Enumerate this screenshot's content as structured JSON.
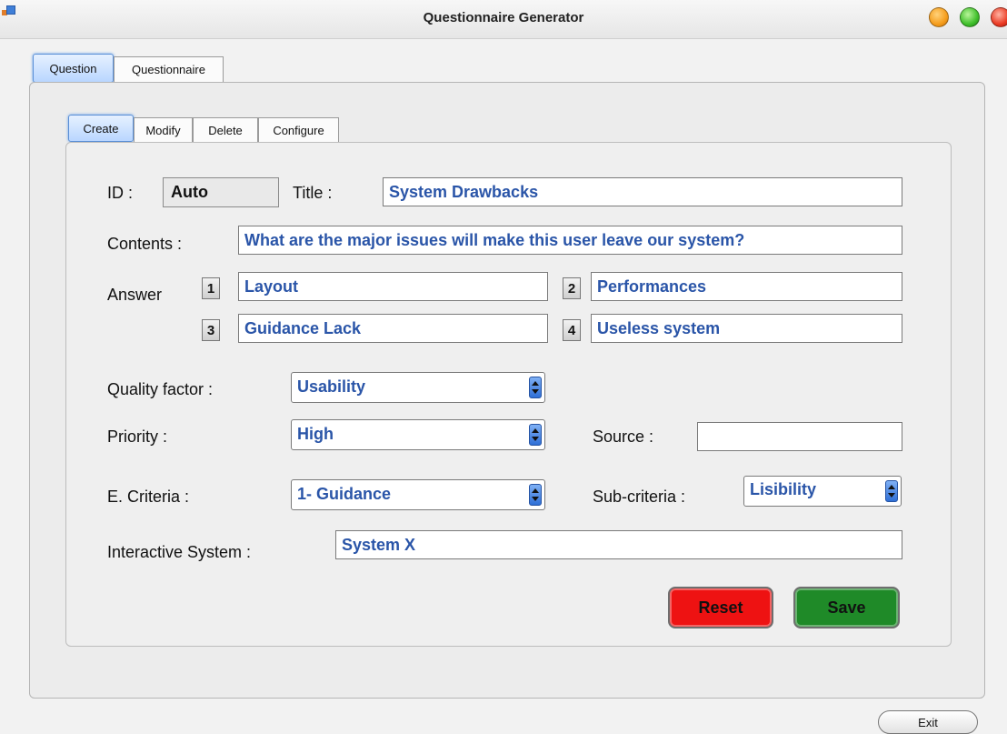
{
  "window": {
    "title": "Questionnaire Generator"
  },
  "main_tabs": [
    {
      "label": "Question",
      "active": true
    },
    {
      "label": "Questionnaire",
      "active": false
    }
  ],
  "sub_tabs": [
    {
      "label": "Create",
      "active": true
    },
    {
      "label": "Modify",
      "active": false
    },
    {
      "label": "Delete",
      "active": false
    },
    {
      "label": "Configure",
      "active": false
    }
  ],
  "form": {
    "id_label": "ID :",
    "id_value": "Auto",
    "title_label": "Title :",
    "title_value": "System Drawbacks",
    "contents_label": "Contents :",
    "contents_value": "What are the major issues will make this user leave our system?",
    "answer_label": "Answer",
    "answers": [
      {
        "number": "1",
        "value": "Layout"
      },
      {
        "number": "2",
        "value": "Performances"
      },
      {
        "number": "3",
        "value": "Guidance Lack"
      },
      {
        "number": "4",
        "value": "Useless system"
      }
    ],
    "quality_factor_label": "Quality factor :",
    "quality_factor_value": "Usability",
    "priority_label": "Priority :",
    "priority_value": "High",
    "source_label": "Source :",
    "source_value": "",
    "e_criteria_label": "E. Criteria :",
    "e_criteria_value": "1- Guidance",
    "sub_criteria_label": "Sub-criteria :",
    "sub_criteria_value": "Lisibility",
    "interactive_system_label": "Interactive System :",
    "interactive_system_value": "System X"
  },
  "buttons": {
    "reset": "Reset",
    "save": "Save",
    "exit": "Exit"
  },
  "colors": {
    "reset": "#ee1212",
    "save": "#1f8a28",
    "input_text": "#2a55a8",
    "active_tab": "#b9d6ff"
  }
}
